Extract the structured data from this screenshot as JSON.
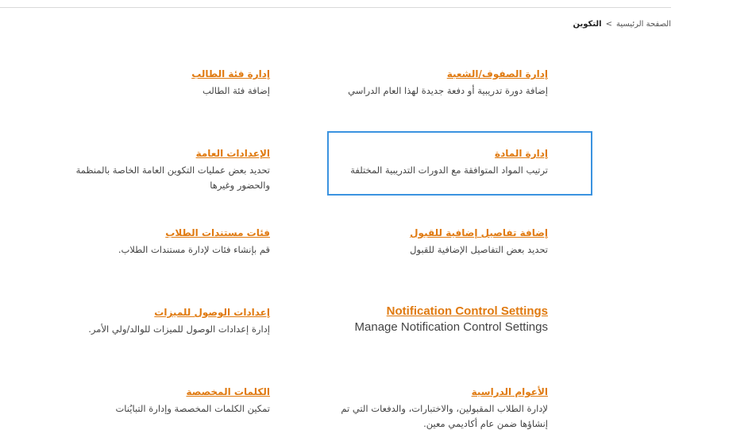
{
  "breadcrumb": {
    "home": "الصفحة الرئيسية",
    "separator": ">",
    "current": "التكوين"
  },
  "cards": {
    "classes": {
      "title": "إدارة الصفوف/الشعبة",
      "desc": "إضافة دورة تدريبية أو دفعة جديدة لهذا العام الدراسي"
    },
    "student_category": {
      "title": "إدارة فئة الطالب",
      "desc": "إضافة فئة الطالب"
    },
    "subject": {
      "title": "إدارة المادة",
      "desc": "ترتيب المواد المتوافقة مع الدورات التدريبية المختلفة"
    },
    "general_settings": {
      "title": "الإعدادات العامة",
      "desc": "تحديد بعض عمليات التكوين العامة الخاصة بالمنظمة والحضور وغيرها"
    },
    "admission_details": {
      "title": "إضافة تفاصيل إضافية للقبول",
      "desc": "تحديد بعض التفاصيل الإضافية للقبول"
    },
    "student_documents": {
      "title": "فئات مستندات الطلاب",
      "desc": "قم بإنشاء فئات لإدارة مستندات الطلاب."
    },
    "notification": {
      "title": "Notification Control Settings",
      "desc": "Manage Notification Control Settings"
    },
    "feature_access": {
      "title": "إعدادات الوصول للميزات",
      "desc": "إدارة إعدادات الوصول للميزات للوالد/ولي الأمر."
    },
    "academic_years": {
      "title": "الأعوام الدراسية",
      "desc": "لإدارة الطلاب المقبولين، والاختبارات، والدفعات التي تم إنشاؤها ضمن عام أكاديمي معين."
    },
    "custom_words": {
      "title": "الكلمات المخصصة",
      "desc": "تمكين الكلمات المخصصة وإدارة التبايُنات"
    }
  },
  "colors": {
    "link": "#e07a10",
    "highlight_border": "#3b93e0",
    "text": "#444444"
  }
}
